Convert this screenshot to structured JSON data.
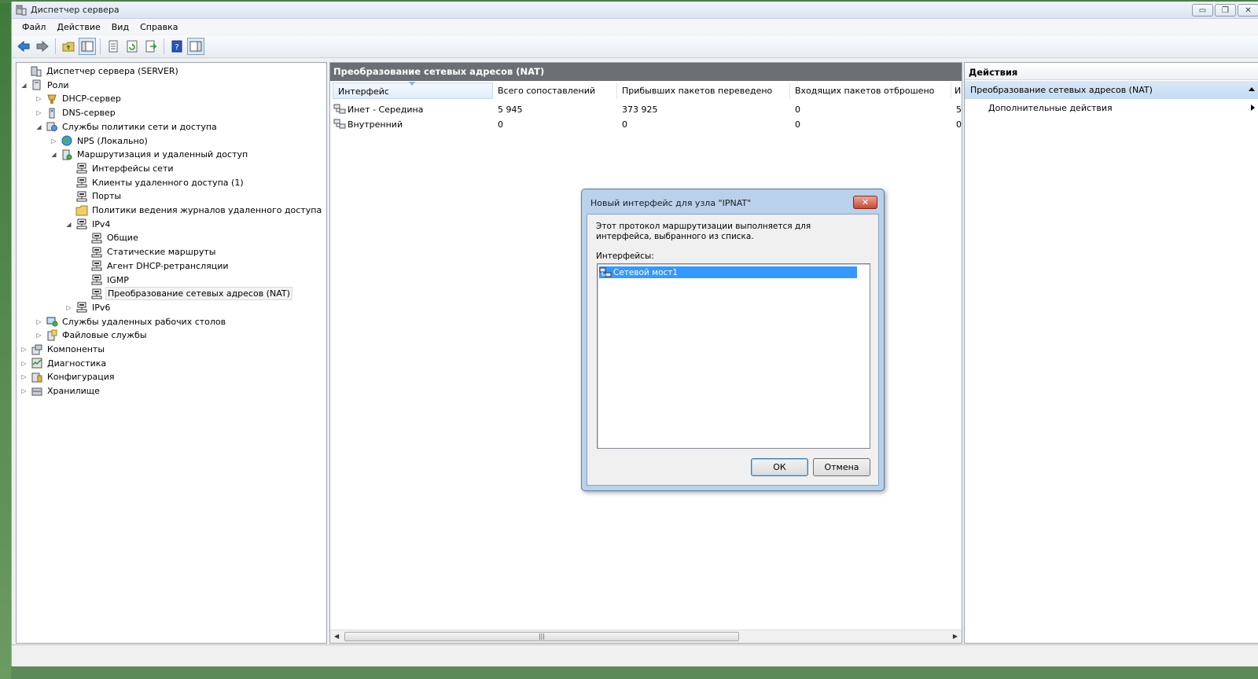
{
  "window": {
    "title": "Диспетчер сервера",
    "controls": {
      "minimize": "▭",
      "restore": "❐",
      "close": "✕"
    }
  },
  "menu": [
    "Файл",
    "Действие",
    "Вид",
    "Справка"
  ],
  "toolbar": {
    "icons": [
      "back-arrow-icon",
      "forward-arrow-icon",
      "up-folder-icon",
      "show-tree-icon",
      "properties-icon",
      "refresh-icon",
      "export-icon",
      "help-icon",
      "action-pane-icon"
    ]
  },
  "tree": {
    "items": [
      {
        "label": "Диспетчер сервера (SERVER)",
        "level": 0,
        "expander": "",
        "icon": "server-manager-icon"
      },
      {
        "label": "Роли",
        "level": 1,
        "expander": "◢",
        "icon": "roles-icon"
      },
      {
        "label": "DHCP-сервер",
        "level": 2,
        "expander": "▷",
        "icon": "dhcp-icon"
      },
      {
        "label": "DNS-сервер",
        "level": 2,
        "expander": "▷",
        "icon": "dns-icon"
      },
      {
        "label": "Службы политики сети и доступа",
        "level": 2,
        "expander": "◢",
        "icon": "network-policy-icon"
      },
      {
        "label": "NPS (Локально)",
        "level": 3,
        "expander": "▷",
        "icon": "globe-icon"
      },
      {
        "label": "Маршрутизация и удаленный доступ",
        "level": 3,
        "expander": "◢",
        "icon": "routing-icon"
      },
      {
        "label": "Интерфейсы сети",
        "level": 4,
        "expander": "",
        "icon": "network-node-icon"
      },
      {
        "label": "Клиенты удаленного доступа (1)",
        "level": 4,
        "expander": "",
        "icon": "network-node-icon"
      },
      {
        "label": "Порты",
        "level": 4,
        "expander": "",
        "icon": "network-node-icon"
      },
      {
        "label": "Политики ведения журналов удаленного доступа",
        "level": 4,
        "expander": "",
        "icon": "folder-icon"
      },
      {
        "label": "IPv4",
        "level": 4,
        "expander": "◢",
        "icon": "network-node-icon"
      },
      {
        "label": "Общие",
        "level": 5,
        "expander": "",
        "icon": "network-node-icon"
      },
      {
        "label": "Статические маршруты",
        "level": 5,
        "expander": "",
        "icon": "network-node-icon"
      },
      {
        "label": "Агент DHCP-ретрансляции",
        "level": 5,
        "expander": "",
        "icon": "network-node-icon"
      },
      {
        "label": "IGMP",
        "level": 5,
        "expander": "",
        "icon": "network-node-icon"
      },
      {
        "label": "Преобразование сетевых адресов (NAT)",
        "level": 5,
        "expander": "",
        "icon": "network-node-icon",
        "selected": true
      },
      {
        "label": "IPv6",
        "level": 4,
        "expander": "▷",
        "icon": "network-node-icon"
      },
      {
        "label": "Службы удаленных рабочих столов",
        "level": 2,
        "expander": "▷",
        "icon": "remote-desktop-icon"
      },
      {
        "label": "Файловые службы",
        "level": 2,
        "expander": "▷",
        "icon": "file-services-icon"
      },
      {
        "label": "Компоненты",
        "level": 1,
        "expander": "▷",
        "icon": "features-icon"
      },
      {
        "label": "Диагностика",
        "level": 1,
        "expander": "▷",
        "icon": "diagnostics-icon"
      },
      {
        "label": "Конфигурация",
        "level": 1,
        "expander": "▷",
        "icon": "configuration-icon"
      },
      {
        "label": "Хранилище",
        "level": 1,
        "expander": "▷",
        "icon": "storage-icon"
      }
    ]
  },
  "center": {
    "header": "Преобразование сетевых адресов (NAT)",
    "columns": [
      "Интерфейс",
      "Всего сопоставлений",
      "Прибывших пакетов переведено",
      "Входящих пакетов отброшено",
      "И"
    ],
    "rows": [
      {
        "interface": "Инет - Середина",
        "total": "5 945",
        "translated": "373 925",
        "dropped": "0",
        "extra": "5"
      },
      {
        "interface": "Внутренний",
        "total": "0",
        "translated": "0",
        "dropped": "0",
        "extra": "0"
      }
    ],
    "scroll_thumb": "|||"
  },
  "actions": {
    "header": "Действия",
    "section": "Преобразование сетевых адресов (NAT)",
    "item": "Дополнительные действия"
  },
  "dialog": {
    "title": "Новый интерфейс для узла \"IPNAT\"",
    "close": "✕",
    "description": "Этот протокол маршрутизации выполняется для интерфейса, выбранного из списка.",
    "list_label": "Интерфейсы:",
    "list_items": [
      "Сетевой мост1"
    ],
    "ok_label": "ОК",
    "cancel_label": "Отмена"
  },
  "colors": {
    "selection": "#3399ff",
    "pane_header": "#6b6f73",
    "actions_section": "#c4dbf1"
  }
}
